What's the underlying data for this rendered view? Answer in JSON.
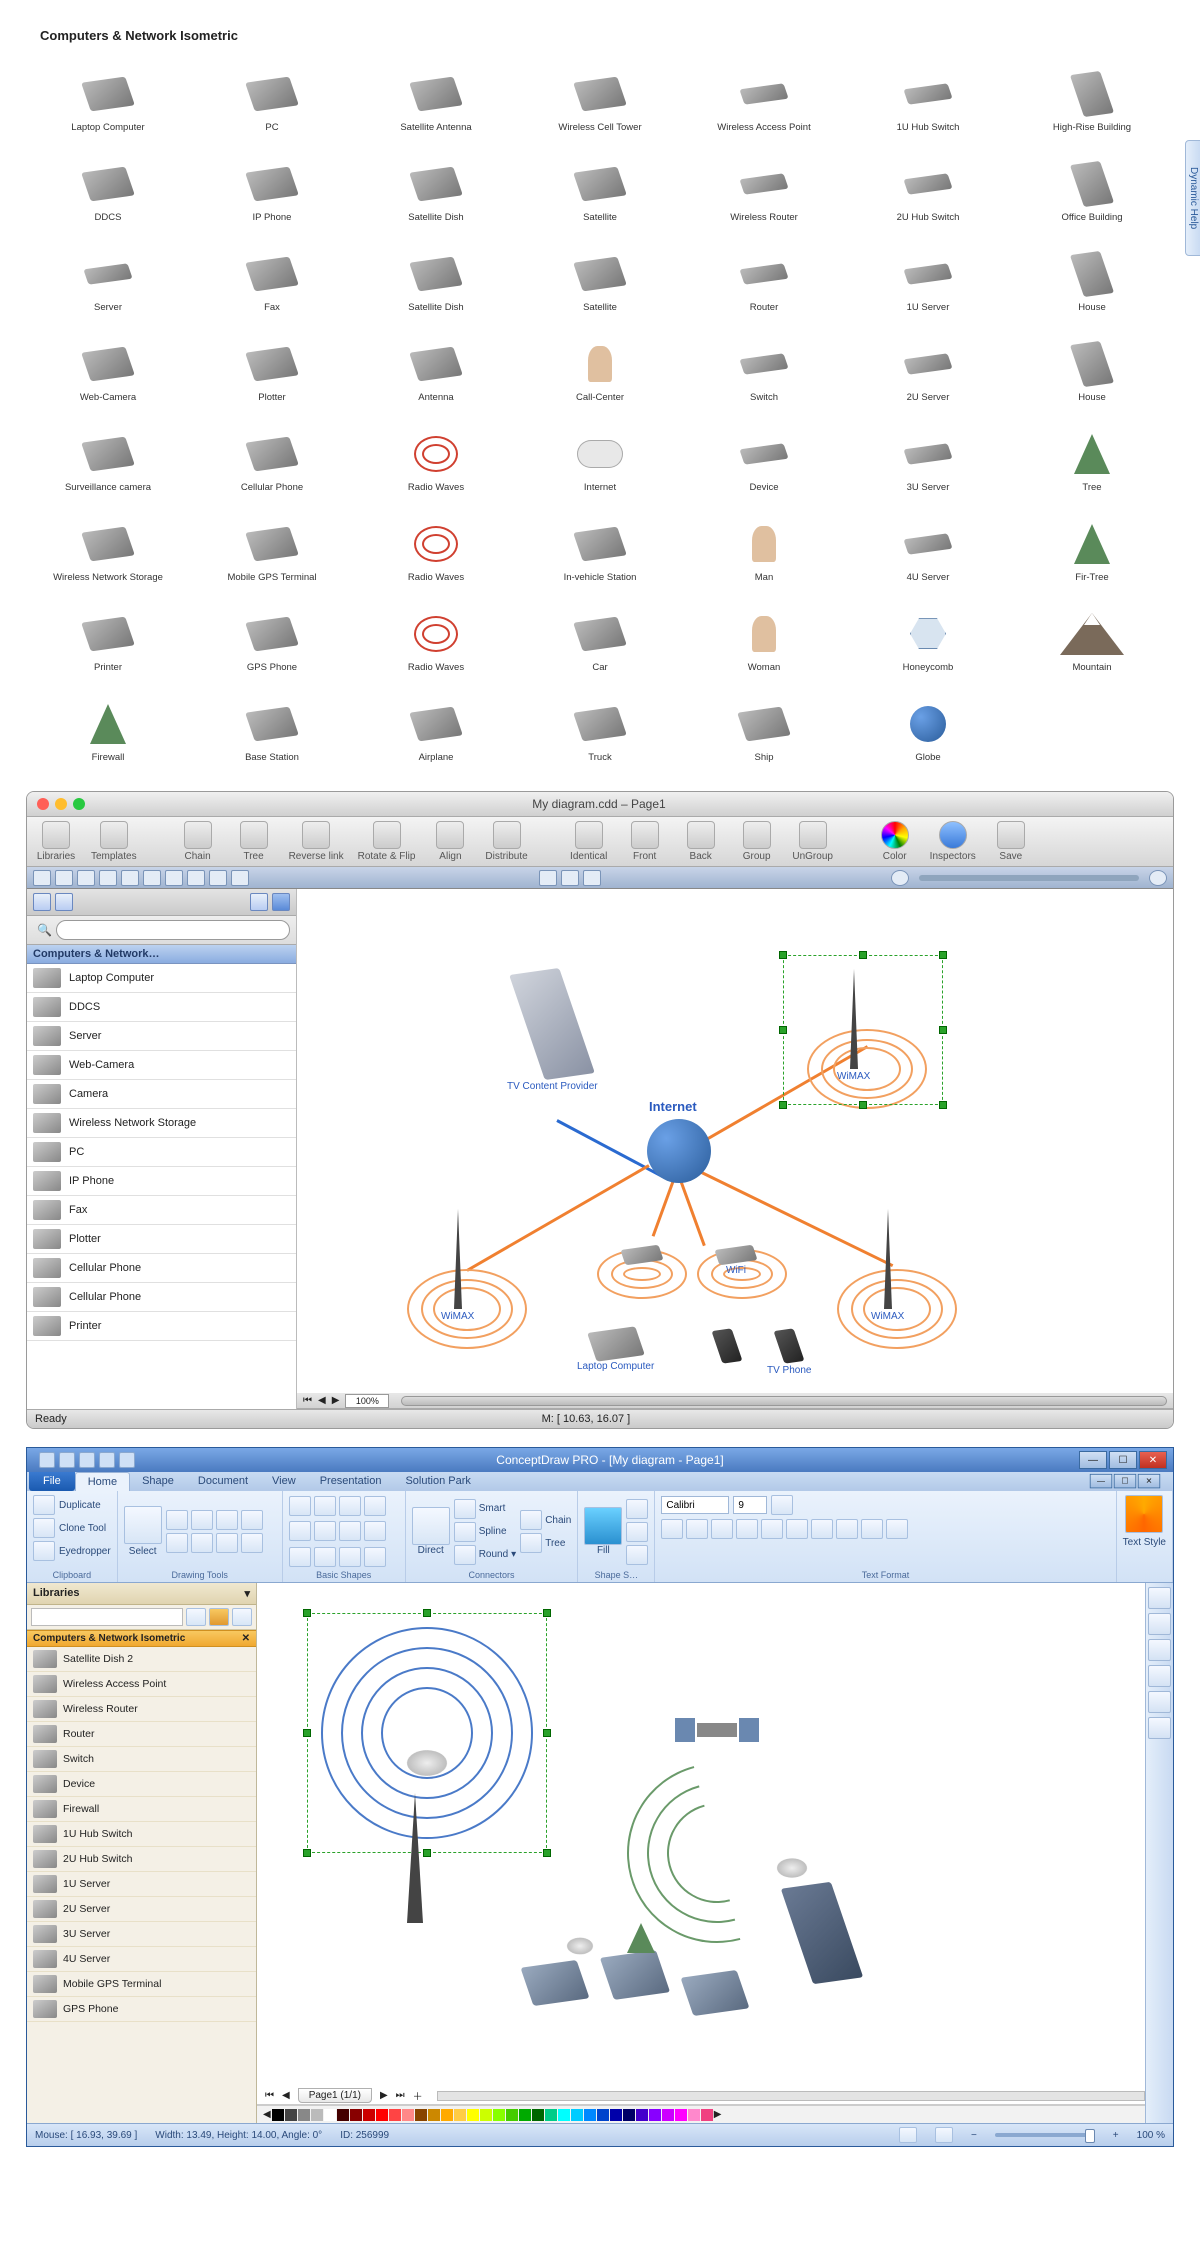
{
  "library": {
    "title": "Computers & Network Isometric",
    "columns": [
      [
        "Laptop Computer",
        "DDCS",
        "Server",
        "Web-Camera",
        "Surveillance camera",
        "Wireless Network Storage",
        "Printer",
        "Firewall"
      ],
      [
        "PC",
        "IP Phone",
        "Fax",
        "Plotter",
        "Cellular Phone",
        "Mobile GPS Terminal",
        "GPS Phone",
        "Base Station"
      ],
      [
        "Satellite Antenna",
        "Satellite Dish",
        "Satellite Dish",
        "Antenna",
        "Radio Waves",
        "Radio Waves",
        "Radio Waves",
        "Airplane"
      ],
      [
        "Wireless Cell Tower",
        "Satellite",
        "Satellite",
        "Call-Center",
        "Internet",
        "In-vehicle Station",
        "Car",
        "Truck"
      ],
      [
        "Wireless Access Point",
        "Wireless Router",
        "Router",
        "Switch",
        "Device",
        "Man",
        "Woman",
        "Ship"
      ],
      [
        "1U Hub Switch",
        "2U Hub Switch",
        "1U Server",
        "2U Server",
        "3U Server",
        "4U Server",
        "Honeycomb",
        "Globe"
      ],
      [
        "High-Rise Building",
        "Office Building",
        "House",
        "House",
        "Tree",
        "Fir-Tree",
        "Mountain"
      ]
    ]
  },
  "mac": {
    "title": "My diagram.cdd – Page1",
    "toolbar": [
      "Libraries",
      "Templates",
      "Chain",
      "Tree",
      "Reverse link",
      "Rotate & Flip",
      "Align",
      "Distribute",
      "Identical",
      "Front",
      "Back",
      "Group",
      "UnGroup",
      "Color",
      "Inspectors",
      "Save"
    ],
    "sidebar_header": "Computers & Network…",
    "sidebar_items": [
      "Laptop Computer",
      "DDCS",
      "Server",
      "Web-Camera",
      "Camera",
      "Wireless Network Storage",
      "PC",
      "IP Phone",
      "Fax",
      "Plotter",
      "Cellular Phone",
      "Cellular Phone",
      "Printer"
    ],
    "search_placeholder": "",
    "zoom": "100%",
    "status_left": "Ready",
    "status_center": "M: [ 10.63, 16.07 ]",
    "canvas_nodes": {
      "internet": "Internet",
      "tv_content": "TV Content Provider",
      "wimax": "WiMAX",
      "wifi": "WiFi",
      "laptop": "Laptop Computer",
      "tvphone": "TV Phone"
    }
  },
  "win": {
    "title": "ConceptDraw PRO - [My diagram - Page1]",
    "tabs": [
      "Home",
      "Shape",
      "Document",
      "View",
      "Presentation",
      "Solution Park"
    ],
    "file_tab": "File",
    "ribbon_groups": {
      "clipboard": {
        "title": "Clipboard",
        "items": [
          "Duplicate",
          "Clone Tool",
          "Eyedropper"
        ]
      },
      "drawing": {
        "title": "Drawing Tools",
        "select": "Select"
      },
      "shapes": {
        "title": "Basic Shapes"
      },
      "connectors": {
        "title": "Connectors",
        "direct": "Direct",
        "items": [
          "Smart",
          "Spline",
          "Round"
        ],
        "right": [
          "Chain",
          "Tree"
        ]
      },
      "shape_s": {
        "title": "Shape S…",
        "fill": "Fill"
      },
      "text_format": {
        "title": "Text Format",
        "font": "Calibri",
        "size": "9",
        "style_btn": "Text Style"
      }
    },
    "side_title": "Libraries",
    "lib_header": "Computers & Network Isometric",
    "lib_items": [
      "Satellite Dish 2",
      "Wireless Access Point",
      "Wireless Router",
      "Router",
      "Switch",
      "Device",
      "Firewall",
      "1U Hub Switch",
      "2U Hub Switch",
      "1U Server",
      "2U Server",
      "3U Server",
      "4U Server",
      "Mobile GPS Terminal",
      "GPS Phone"
    ],
    "page_tab": "Page1 (1/1)",
    "dynamic_help": "Dynamic Help",
    "status": {
      "mouse": "Mouse: [ 16.93, 39.69 ]",
      "dims": "Width: 13.49,  Height: 14.00,  Angle: 0°",
      "id": "ID: 256999",
      "zoom": "100 %"
    },
    "color_swatches": [
      "#000",
      "#444",
      "#888",
      "#bbb",
      "#fff",
      "#400",
      "#800",
      "#c00",
      "#f00",
      "#f44",
      "#f88",
      "#840",
      "#c80",
      "#fa0",
      "#fc4",
      "#ff0",
      "#cf0",
      "#8f0",
      "#4c0",
      "#0a0",
      "#060",
      "#0c8",
      "#0ff",
      "#0cf",
      "#08f",
      "#04c",
      "#00a",
      "#006",
      "#40c",
      "#80f",
      "#c0f",
      "#f0f",
      "#f8c",
      "#f04080"
    ]
  }
}
